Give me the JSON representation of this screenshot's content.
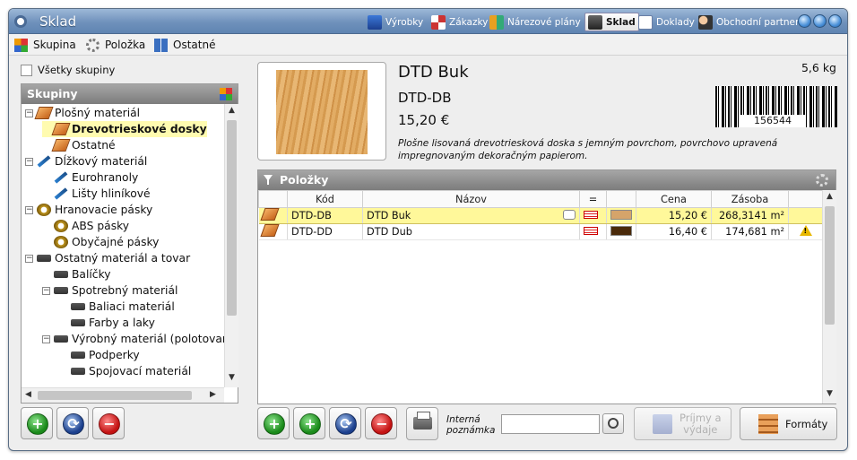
{
  "window": {
    "title": "Sklad"
  },
  "top_nav": [
    {
      "label": "Výrobky",
      "icon": "products-icon"
    },
    {
      "label": "Zákazky",
      "icon": "orders-icon"
    },
    {
      "label": "Nárezové plány",
      "icon": "cutting-plans-icon"
    },
    {
      "label": "Sklad",
      "icon": "warehouse-icon",
      "active": true
    },
    {
      "label": "Doklady",
      "icon": "documents-icon"
    },
    {
      "label": "Obchodní partneri",
      "icon": "partners-icon"
    }
  ],
  "menu": [
    {
      "label": "Skupina",
      "icon": "group-icon"
    },
    {
      "label": "Položka",
      "icon": "item-gear-icon"
    },
    {
      "label": "Ostatné",
      "icon": "book-icon"
    }
  ],
  "groups": {
    "all_groups_label": "Všetky skupiny",
    "all_groups_checked": false,
    "header": "Skupiny",
    "tree": [
      {
        "label": "Plošný materiál",
        "level": 0,
        "toggle": "−",
        "icon": "plank"
      },
      {
        "label": "Drevotrieskové dosky",
        "level": 1,
        "icon": "plank",
        "selected": true
      },
      {
        "label": "Ostatné",
        "level": 1,
        "icon": "plank"
      },
      {
        "label": "Dĺžkový materiál",
        "level": 0,
        "toggle": "−",
        "icon": "stick"
      },
      {
        "label": "Eurohranoly",
        "level": 1,
        "icon": "stick"
      },
      {
        "label": "Lišty hliníkové",
        "level": 1,
        "icon": "stick"
      },
      {
        "label": "Hranovacie pásky",
        "level": 0,
        "toggle": "−",
        "icon": "tape"
      },
      {
        "label": "ABS pásky",
        "level": 1,
        "icon": "tape"
      },
      {
        "label": "Obyčajné pásky",
        "level": 1,
        "icon": "tape"
      },
      {
        "label": "Ostatný materiál a tovar",
        "level": 0,
        "toggle": "−",
        "icon": "misc"
      },
      {
        "label": "Balíčky",
        "level": 1,
        "icon": "misc"
      },
      {
        "label": "Spotrebný materiál",
        "level": 1,
        "toggle": "−",
        "icon": "misc"
      },
      {
        "label": "Baliaci materiál",
        "level": 2,
        "icon": "misc"
      },
      {
        "label": "Farby a laky",
        "level": 2,
        "icon": "misc"
      },
      {
        "label": "Výrobný materiál (polotovary)",
        "level": 1,
        "toggle": "−",
        "icon": "misc"
      },
      {
        "label": "Podperky",
        "level": 2,
        "icon": "misc"
      },
      {
        "label": "Spojovací materiál",
        "level": 2,
        "icon": "misc"
      }
    ]
  },
  "product": {
    "name": "DTD Buk",
    "code": "DTD-DB",
    "price": "15,20 €",
    "weight": "5,6 kg",
    "barcode": "156544",
    "description": "Plošne lisovaná drevotriesková doska s jemným povrchom, povrchovo upravená impregnovaným dekoračným papierom."
  },
  "items": {
    "header": "Položky",
    "columns": [
      "",
      "Kód",
      "Názov",
      "=",
      "",
      "Cena",
      "Zásoba",
      ""
    ],
    "rows": [
      {
        "code": "DTD-DB",
        "name": "DTD Buk",
        "price": "15,20 €",
        "stock": "268,3141 m²",
        "color": "#d5a46a",
        "warning": false,
        "highlight": true
      },
      {
        "code": "DTD-DD",
        "name": "DTD Dub",
        "price": "16,40 €",
        "stock": "174,681 m²",
        "color": "#4a2a0a",
        "warning": true,
        "highlight": false
      }
    ]
  },
  "bottom": {
    "note_label_1": "Interná",
    "note_label_2": "poznámka",
    "note_value": "",
    "prijmy_label_1": "Príjmy a",
    "prijmy_label_2": "výdaje",
    "formaty_label": "Formáty"
  }
}
